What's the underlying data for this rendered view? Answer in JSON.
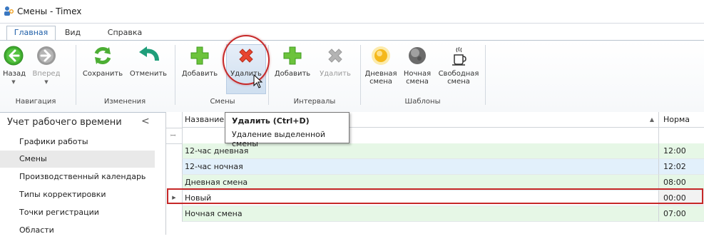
{
  "window": {
    "title": "Смены - Timex"
  },
  "tabs": [
    {
      "label": "Главная",
      "active": true
    },
    {
      "label": "Вид",
      "active": false
    },
    {
      "label": "Справка",
      "active": false
    }
  ],
  "ribbon": {
    "groups": {
      "navigation": "Навигация",
      "changes": "Изменения",
      "shifts": "Смены",
      "intervals": "Интервалы",
      "templates": "Шаблоны"
    },
    "buttons": {
      "back": "Назад",
      "forward": "Вперед",
      "save": "Сохранить",
      "undo": "Отменить",
      "shift_add": "Добавить",
      "shift_delete": "Удалить",
      "interval_add": "Добавить",
      "interval_delete": "Удалить",
      "day_shift_1": "Дневная",
      "day_shift_2": "смена",
      "night_shift_1": "Ночная",
      "night_shift_2": "смена",
      "free_shift_1": "Свободная",
      "free_shift_2": "смена"
    }
  },
  "tooltip": {
    "title": "Удалить (Ctrl+D)",
    "description": "Удаление выделенной смены"
  },
  "sidebar": {
    "header": "Учет рабочего времени",
    "collapse_glyph": "<",
    "items": [
      {
        "label": "Графики работы",
        "selected": false
      },
      {
        "label": "Смены",
        "selected": true
      },
      {
        "label": "Производственный календарь",
        "selected": false
      },
      {
        "label": "Типы корректировки",
        "selected": false
      },
      {
        "label": "Точки регистрации",
        "selected": false
      },
      {
        "label": "Области",
        "selected": false
      }
    ]
  },
  "grid": {
    "columns": {
      "name": "Название",
      "norm": "Норма"
    },
    "rows": [
      {
        "name": "12-час дневная",
        "norm": "12:00",
        "color": "#e6f7e6"
      },
      {
        "name": "12-час ночная",
        "norm": "12:02",
        "color": "#e2f0fb"
      },
      {
        "name": "Дневная смена",
        "norm": "08:00",
        "color": "#e6f7e6"
      },
      {
        "name": "Новый",
        "norm": "00:00",
        "color": "#ffffff",
        "current": true
      },
      {
        "name": "Ночная смена",
        "norm": "07:00",
        "color": "#e6f7e6"
      }
    ]
  },
  "colors": {
    "accent": "#1f5fa8",
    "highlight": "#c62828",
    "add_green": "#5cb82e",
    "delete_red": "#e0352b"
  }
}
